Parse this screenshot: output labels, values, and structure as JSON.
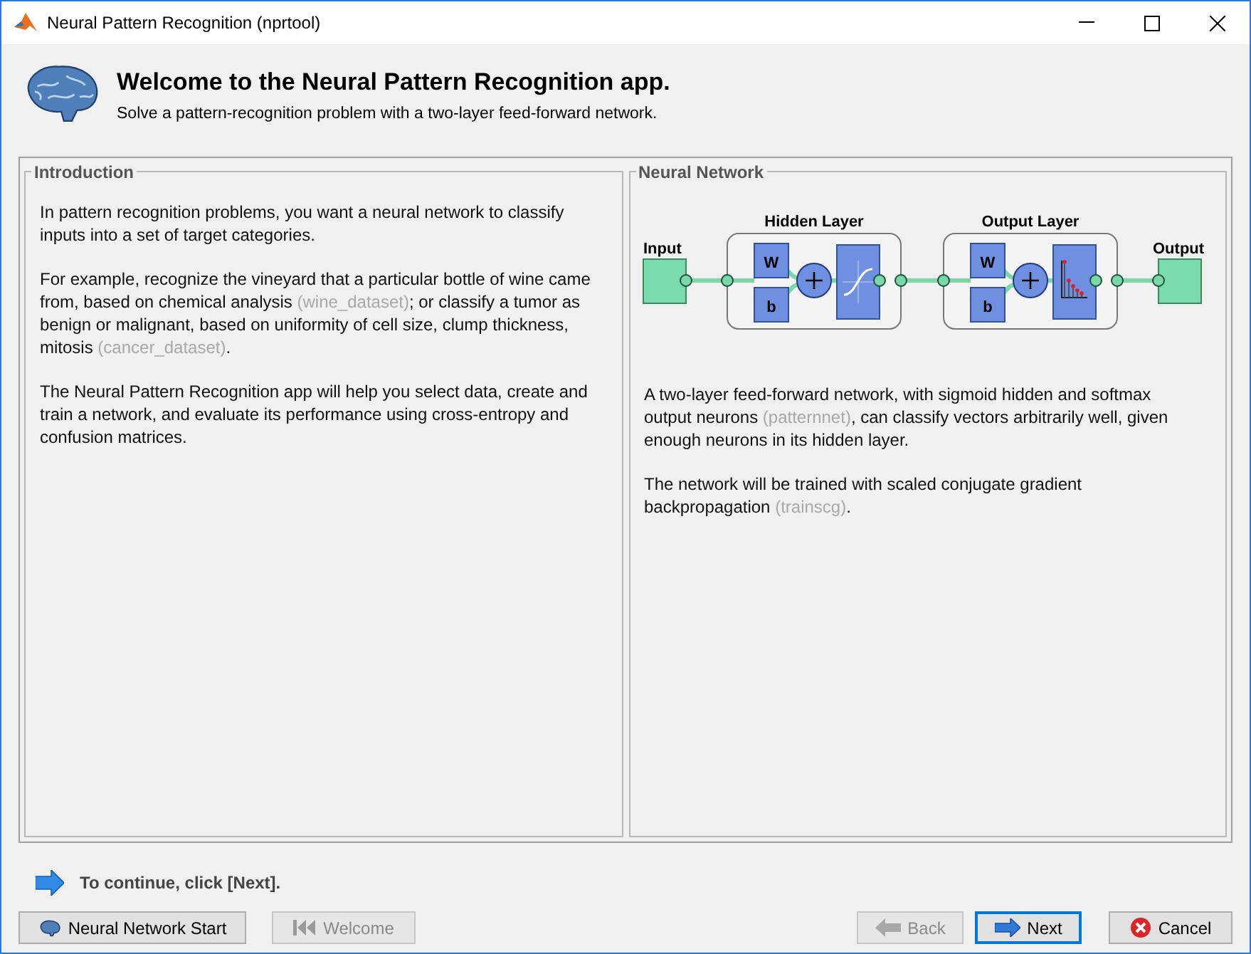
{
  "window": {
    "title": "Neural Pattern Recognition (nprtool)"
  },
  "header": {
    "title": "Welcome to the Neural Pattern Recognition app.",
    "subtitle": "Solve a pattern-recognition problem with a two-layer feed-forward network."
  },
  "intro": {
    "title": "Introduction",
    "paragraphs": [
      [
        {
          "kind": "text",
          "text": "In pattern recognition problems, you want a neural network to classify inputs into a set of target categories."
        }
      ],
      [
        {
          "kind": "text",
          "text": "For example, recognize the vineyard that a particular bottle of wine came from, based on chemical analysis "
        },
        {
          "kind": "link",
          "text": "(wine_dataset)"
        },
        {
          "kind": "text",
          "text": "; or classify a tumor as benign or malignant, based on uniformity of cell size, clump thickness, mitosis "
        },
        {
          "kind": "link",
          "text": "(cancer_dataset)"
        },
        {
          "kind": "text",
          "text": "."
        }
      ],
      [
        {
          "kind": "text",
          "text": "The Neural Pattern Recognition app will help you select data, create and train a network, and evaluate its performance using cross-entropy and confusion matrices."
        }
      ]
    ]
  },
  "network": {
    "title": "Neural Network",
    "diagram": {
      "input": "Input",
      "output": "Output",
      "layers": [
        {
          "title": "Hidden Layer",
          "weight": "W",
          "bias": "b"
        },
        {
          "title": "Output Layer",
          "weight": "W",
          "bias": "b"
        }
      ]
    },
    "paragraphs": [
      [
        {
          "kind": "text",
          "text": "A two-layer feed-forward network, with sigmoid hidden and softmax output neurons "
        },
        {
          "kind": "link",
          "text": "(patternnet)"
        },
        {
          "kind": "text",
          "text": ", can classify vectors arbitrarily well, given enough neurons in its hidden layer."
        }
      ],
      [
        {
          "kind": "text",
          "text": "The network will be trained with scaled conjugate gradient backpropagation "
        },
        {
          "kind": "link",
          "text": "(trainscg)"
        },
        {
          "kind": "text",
          "text": "."
        }
      ]
    ]
  },
  "hint": "To continue, click [Next].",
  "left_buttons": [
    {
      "label": "Neural Network Start",
      "disabled": false,
      "default": false
    },
    {
      "label": "Welcome",
      "disabled": true,
      "default": false
    }
  ],
  "right_buttons": [
    {
      "label": "Back",
      "disabled": true,
      "default": false
    },
    {
      "label": "Next",
      "disabled": false,
      "default": true
    },
    {
      "label": "Cancel",
      "disabled": false,
      "default": false
    }
  ]
}
